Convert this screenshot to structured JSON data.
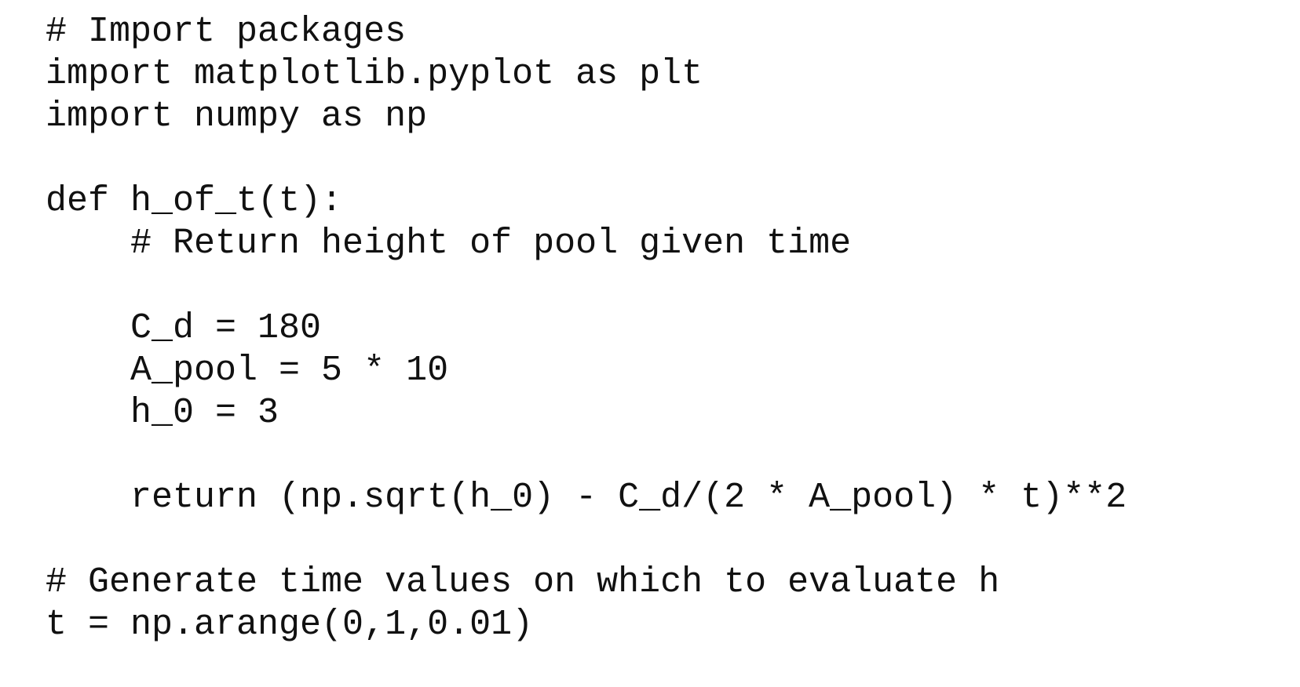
{
  "code": {
    "language": "python",
    "lines": [
      "# Import packages",
      "import matplotlib.pyplot as plt",
      "import numpy as np",
      "",
      "def h_of_t(t):",
      "    # Return height of pool given time",
      "",
      "    C_d = 180",
      "    A_pool = 5 * 10",
      "    h_0 = 3",
      "",
      "    return (np.sqrt(h_0) - C_d/(2 * A_pool) * t)**2",
      "",
      "# Generate time values on which to evaluate h",
      "t = np.arange(0,1,0.01)"
    ]
  }
}
